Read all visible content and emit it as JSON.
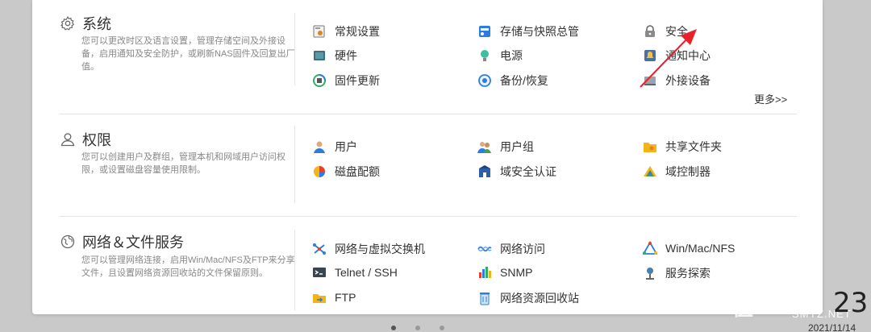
{
  "sections": [
    {
      "title": "系统",
      "icon": "gear-icon",
      "description": "您可以更改时区及语言设置，管理存储空间及外接设备，启用通知及安全防护，或刷新NAS固件及回复出厂值。",
      "items": [
        {
          "label": "常规设置",
          "icon": "general-settings-icon"
        },
        {
          "label": "存储与快照总管",
          "icon": "storage-snapshot-icon"
        },
        {
          "label": "安全",
          "icon": "lock-icon"
        },
        {
          "label": "硬件",
          "icon": "hardware-icon"
        },
        {
          "label": "电源",
          "icon": "power-bulb-icon"
        },
        {
          "label": "通知中心",
          "icon": "notification-center-icon"
        },
        {
          "label": "固件更新",
          "icon": "firmware-update-icon"
        },
        {
          "label": "备份/恢复",
          "icon": "backup-restore-icon"
        },
        {
          "label": "外接设备",
          "icon": "external-device-icon"
        }
      ],
      "more_label": "更多>>"
    },
    {
      "title": "权限",
      "icon": "user-outline-icon",
      "description": "您可以创建用户及群组，管理本机和网域用户访问权限，或设置磁盘容量使用限制。",
      "items": [
        {
          "label": "用户",
          "icon": "user-icon"
        },
        {
          "label": "用户组",
          "icon": "user-group-icon"
        },
        {
          "label": "共享文件夹",
          "icon": "shared-folder-icon"
        },
        {
          "label": "磁盘配额",
          "icon": "disk-quota-icon"
        },
        {
          "label": "域安全认证",
          "icon": "domain-security-icon"
        },
        {
          "label": "域控制器",
          "icon": "domain-controller-icon"
        }
      ]
    },
    {
      "title": "网络＆文件服务",
      "icon": "globe-icon",
      "description": "您可以管理网络连接，启用Win/Mac/NFS及FTP来分享文件，且设置网络资源回收站的文件保留原则。",
      "items": [
        {
          "label": "网络与虚拟交换机",
          "icon": "network-switch-icon"
        },
        {
          "label": "网络访问",
          "icon": "network-access-icon"
        },
        {
          "label": "Win/Mac/NFS",
          "icon": "win-mac-nfs-icon"
        },
        {
          "label": "Telnet / SSH",
          "icon": "terminal-icon"
        },
        {
          "label": "SNMP",
          "icon": "snmp-icon"
        },
        {
          "label": "服务探索",
          "icon": "service-discovery-icon"
        },
        {
          "label": "FTP",
          "icon": "ftp-icon"
        },
        {
          "label": "网络资源回收站",
          "icon": "recycle-bin-icon"
        }
      ]
    }
  ],
  "clock": "23:",
  "date": "2021/11/14",
  "watermark": "值",
  "watermark_text": "SMYZ.NET",
  "colors": {
    "accent": "#e8212a",
    "text": "#333333",
    "muted": "#888888"
  }
}
